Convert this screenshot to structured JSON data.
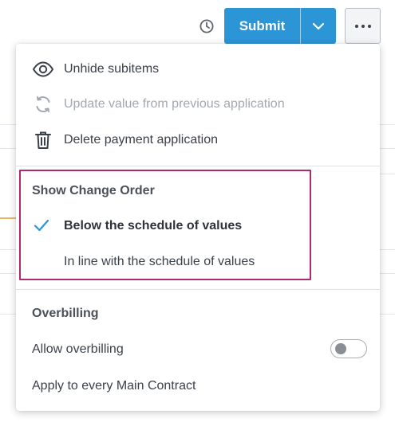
{
  "toolbar": {
    "submit_label": "Submit",
    "history_icon": "clock-icon",
    "caret_icon": "chevron-down-icon",
    "more_icon": "more-horizontal-icon"
  },
  "menu": {
    "actions": [
      {
        "label": "Unhide subitems",
        "icon": "eye-icon",
        "disabled": false
      },
      {
        "label": "Update value from previous application",
        "icon": "refresh-icon",
        "disabled": true
      },
      {
        "label": "Delete payment application",
        "icon": "trash-icon",
        "disabled": false
      }
    ],
    "change_order": {
      "title": "Show Change Order",
      "options": [
        {
          "label": "Below the schedule of values",
          "selected": true
        },
        {
          "label": "In line with the schedule of values",
          "selected": false
        }
      ]
    },
    "overbilling": {
      "title": "Overbilling",
      "allow_label": "Allow overbilling",
      "allow_enabled": false,
      "apply_label": "Apply to every Main Contract"
    }
  },
  "colors": {
    "primary": "#2b95d6",
    "highlight": "#b0286e",
    "check": "#2b95d6"
  }
}
